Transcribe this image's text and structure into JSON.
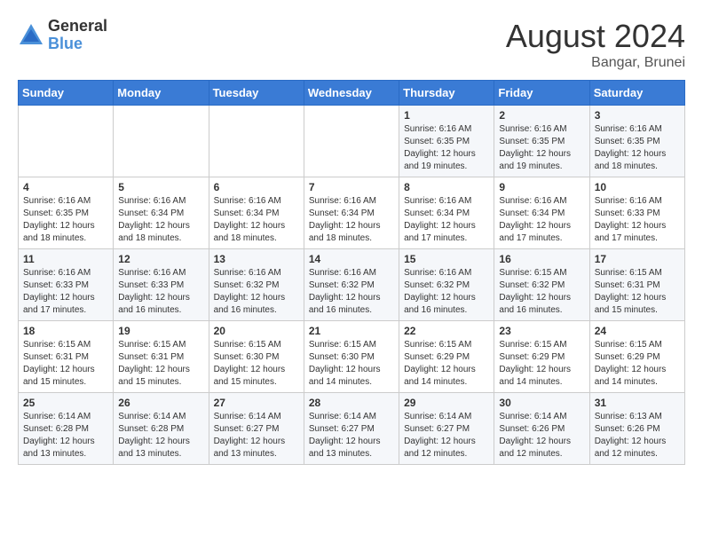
{
  "logo": {
    "general": "General",
    "blue": "Blue"
  },
  "title": "August 2024",
  "location": "Bangar, Brunei",
  "days_of_week": [
    "Sunday",
    "Monday",
    "Tuesday",
    "Wednesday",
    "Thursday",
    "Friday",
    "Saturday"
  ],
  "weeks": [
    [
      {
        "day": "",
        "info": ""
      },
      {
        "day": "",
        "info": ""
      },
      {
        "day": "",
        "info": ""
      },
      {
        "day": "",
        "info": ""
      },
      {
        "day": "1",
        "info": "Sunrise: 6:16 AM\nSunset: 6:35 PM\nDaylight: 12 hours and 19 minutes."
      },
      {
        "day": "2",
        "info": "Sunrise: 6:16 AM\nSunset: 6:35 PM\nDaylight: 12 hours and 19 minutes."
      },
      {
        "day": "3",
        "info": "Sunrise: 6:16 AM\nSunset: 6:35 PM\nDaylight: 12 hours and 18 minutes."
      }
    ],
    [
      {
        "day": "4",
        "info": "Sunrise: 6:16 AM\nSunset: 6:35 PM\nDaylight: 12 hours and 18 minutes."
      },
      {
        "day": "5",
        "info": "Sunrise: 6:16 AM\nSunset: 6:34 PM\nDaylight: 12 hours and 18 minutes."
      },
      {
        "day": "6",
        "info": "Sunrise: 6:16 AM\nSunset: 6:34 PM\nDaylight: 12 hours and 18 minutes."
      },
      {
        "day": "7",
        "info": "Sunrise: 6:16 AM\nSunset: 6:34 PM\nDaylight: 12 hours and 18 minutes."
      },
      {
        "day": "8",
        "info": "Sunrise: 6:16 AM\nSunset: 6:34 PM\nDaylight: 12 hours and 17 minutes."
      },
      {
        "day": "9",
        "info": "Sunrise: 6:16 AM\nSunset: 6:34 PM\nDaylight: 12 hours and 17 minutes."
      },
      {
        "day": "10",
        "info": "Sunrise: 6:16 AM\nSunset: 6:33 PM\nDaylight: 12 hours and 17 minutes."
      }
    ],
    [
      {
        "day": "11",
        "info": "Sunrise: 6:16 AM\nSunset: 6:33 PM\nDaylight: 12 hours and 17 minutes."
      },
      {
        "day": "12",
        "info": "Sunrise: 6:16 AM\nSunset: 6:33 PM\nDaylight: 12 hours and 16 minutes."
      },
      {
        "day": "13",
        "info": "Sunrise: 6:16 AM\nSunset: 6:32 PM\nDaylight: 12 hours and 16 minutes."
      },
      {
        "day": "14",
        "info": "Sunrise: 6:16 AM\nSunset: 6:32 PM\nDaylight: 12 hours and 16 minutes."
      },
      {
        "day": "15",
        "info": "Sunrise: 6:16 AM\nSunset: 6:32 PM\nDaylight: 12 hours and 16 minutes."
      },
      {
        "day": "16",
        "info": "Sunrise: 6:15 AM\nSunset: 6:32 PM\nDaylight: 12 hours and 16 minutes."
      },
      {
        "day": "17",
        "info": "Sunrise: 6:15 AM\nSunset: 6:31 PM\nDaylight: 12 hours and 15 minutes."
      }
    ],
    [
      {
        "day": "18",
        "info": "Sunrise: 6:15 AM\nSunset: 6:31 PM\nDaylight: 12 hours and 15 minutes."
      },
      {
        "day": "19",
        "info": "Sunrise: 6:15 AM\nSunset: 6:31 PM\nDaylight: 12 hours and 15 minutes."
      },
      {
        "day": "20",
        "info": "Sunrise: 6:15 AM\nSunset: 6:30 PM\nDaylight: 12 hours and 15 minutes."
      },
      {
        "day": "21",
        "info": "Sunrise: 6:15 AM\nSunset: 6:30 PM\nDaylight: 12 hours and 14 minutes."
      },
      {
        "day": "22",
        "info": "Sunrise: 6:15 AM\nSunset: 6:29 PM\nDaylight: 12 hours and 14 minutes."
      },
      {
        "day": "23",
        "info": "Sunrise: 6:15 AM\nSunset: 6:29 PM\nDaylight: 12 hours and 14 minutes."
      },
      {
        "day": "24",
        "info": "Sunrise: 6:15 AM\nSunset: 6:29 PM\nDaylight: 12 hours and 14 minutes."
      }
    ],
    [
      {
        "day": "25",
        "info": "Sunrise: 6:14 AM\nSunset: 6:28 PM\nDaylight: 12 hours and 13 minutes."
      },
      {
        "day": "26",
        "info": "Sunrise: 6:14 AM\nSunset: 6:28 PM\nDaylight: 12 hours and 13 minutes."
      },
      {
        "day": "27",
        "info": "Sunrise: 6:14 AM\nSunset: 6:27 PM\nDaylight: 12 hours and 13 minutes."
      },
      {
        "day": "28",
        "info": "Sunrise: 6:14 AM\nSunset: 6:27 PM\nDaylight: 12 hours and 13 minutes."
      },
      {
        "day": "29",
        "info": "Sunrise: 6:14 AM\nSunset: 6:27 PM\nDaylight: 12 hours and 12 minutes."
      },
      {
        "day": "30",
        "info": "Sunrise: 6:14 AM\nSunset: 6:26 PM\nDaylight: 12 hours and 12 minutes."
      },
      {
        "day": "31",
        "info": "Sunrise: 6:13 AM\nSunset: 6:26 PM\nDaylight: 12 hours and 12 minutes."
      }
    ]
  ]
}
